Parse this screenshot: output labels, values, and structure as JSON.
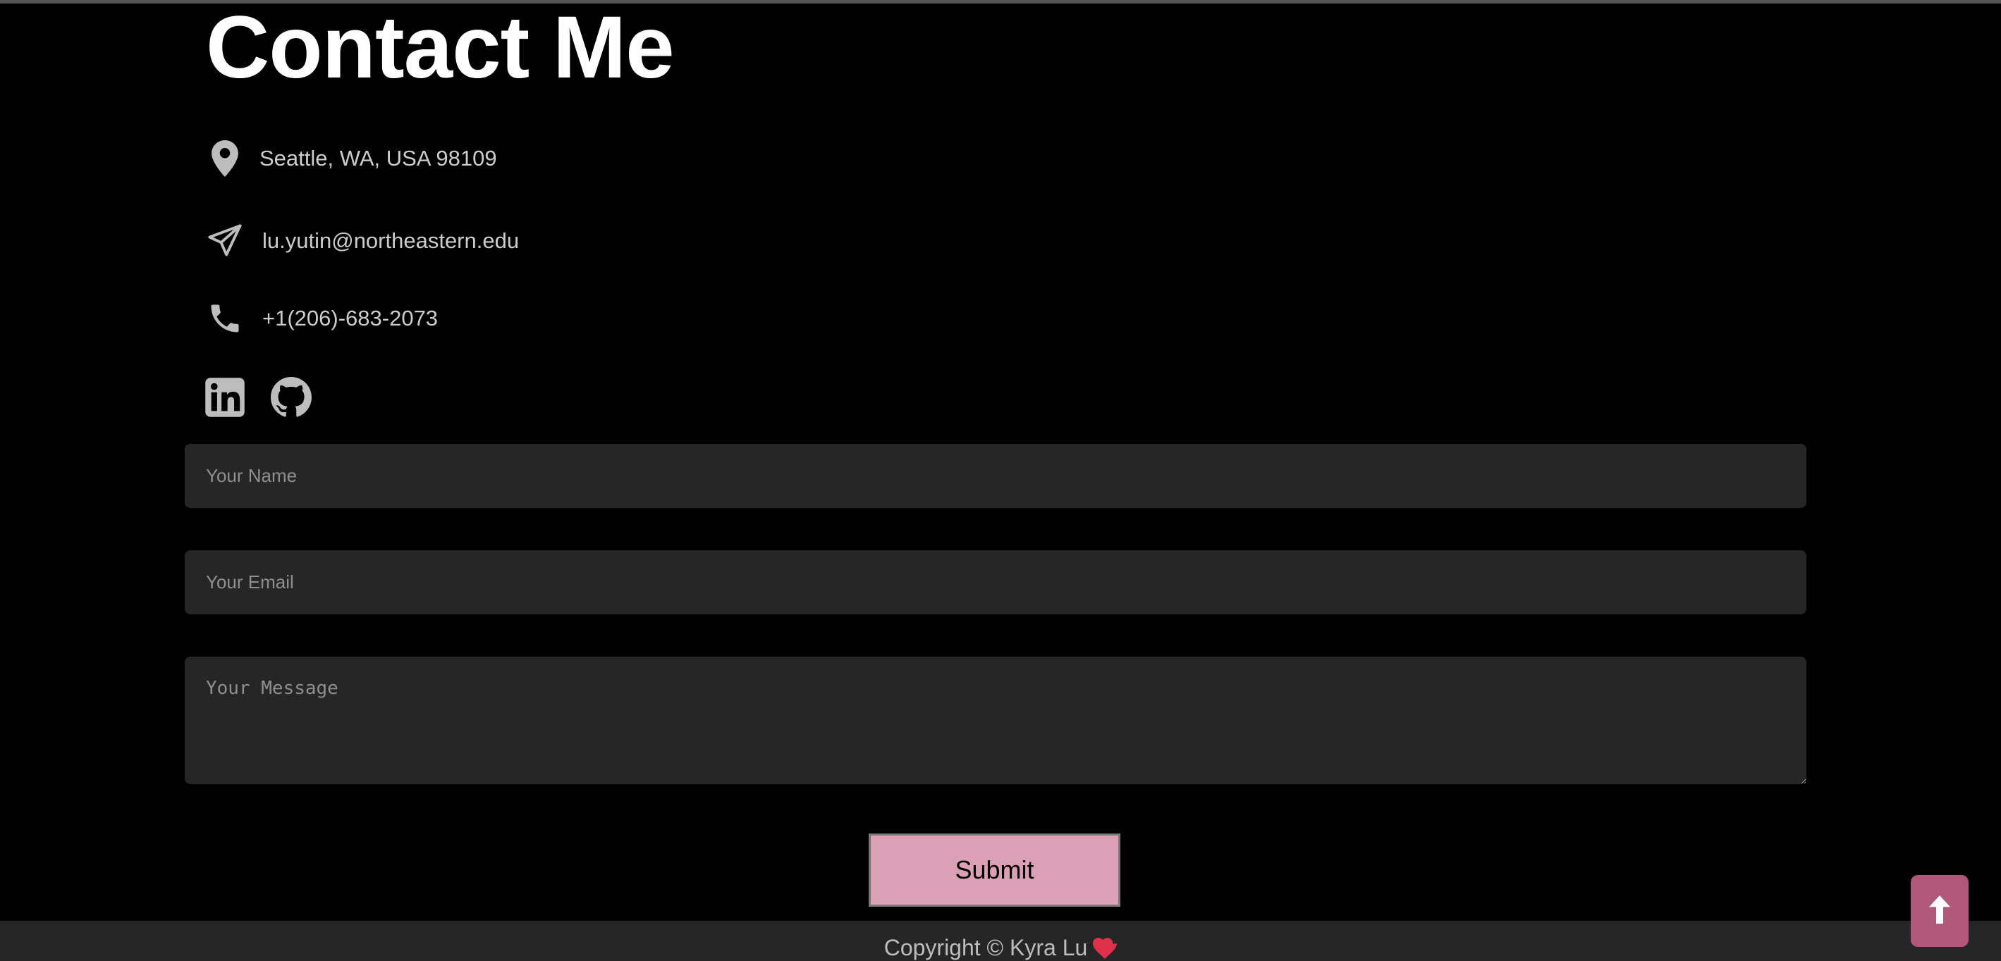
{
  "page": {
    "title": "Contact Me"
  },
  "contact": {
    "location": {
      "icon": "map-pin-icon",
      "text": "Seattle, WA, USA 98109"
    },
    "email": {
      "icon": "paper-plane-icon",
      "text": "lu.yutin@northeastern.edu"
    },
    "phone": {
      "icon": "phone-icon",
      "text": "+1(206)-683-2073"
    }
  },
  "social": [
    {
      "icon": "linkedin-icon"
    },
    {
      "icon": "github-icon"
    }
  ],
  "form": {
    "name_placeholder": "Your Name",
    "email_placeholder": "Your Email",
    "message_placeholder": "Your Message",
    "submit_label": "Submit"
  },
  "footer": {
    "copyright": "Copyright © Kyra Lu",
    "heart_icon": "heart-icon"
  },
  "scroll_top": {
    "icon": "arrow-up-icon"
  },
  "colors": {
    "background": "#000000",
    "title": "#ffffff",
    "text": "#cccccc",
    "field_background": "#262626",
    "submit_background": "#dba0b6",
    "scroll_top_background": "#b0577a",
    "heart": "#e0314b"
  }
}
